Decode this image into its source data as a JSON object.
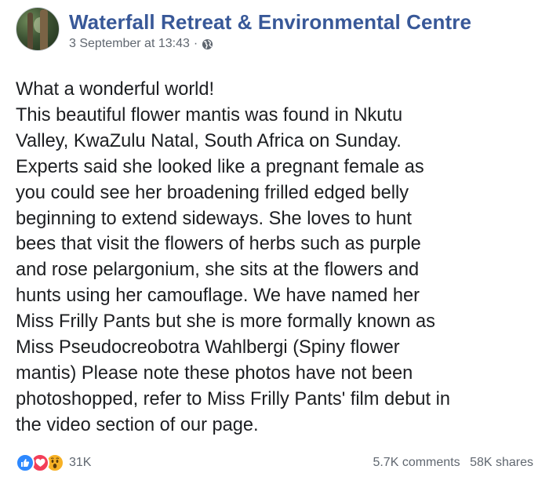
{
  "header": {
    "page_name": "Waterfall Retreat & Environmental Centre",
    "timestamp": "3 September at 13:43",
    "separator": "·",
    "privacy_icon": "globe-icon"
  },
  "post": {
    "lines": [
      "What a wonderful world!",
      "This beautiful flower mantis was found in Nkutu",
      "Valley, KwaZulu Natal, South Africa on Sunday.",
      "Experts said she looked like a pregnant female as",
      "you could see her broadening frilled edged belly",
      "beginning to extend sideways. She loves to hunt",
      "bees that visit the flowers of herbs such as purple",
      "and rose pelargonium, she sits at the flowers and",
      "hunts using her camouflage. We have named her",
      "Miss Frilly Pants but she is more formally known as",
      "Miss Pseudocreobotra Wahlbergi (Spiny flower",
      "mantis) Please note these photos have not been",
      "photoshopped, refer to Miss Frilly Pants' film debut in",
      "the video section of our page."
    ]
  },
  "footer": {
    "reaction_icons": [
      "like-icon",
      "love-icon",
      "wow-icon"
    ],
    "reaction_count": "31K",
    "comments": "5.7K comments",
    "shares": "58K shares"
  },
  "colors": {
    "page_name": "#385898",
    "secondary_text": "#606770",
    "like": "#2d88ff",
    "love": "#f33e58",
    "wow": "#f7b125"
  }
}
